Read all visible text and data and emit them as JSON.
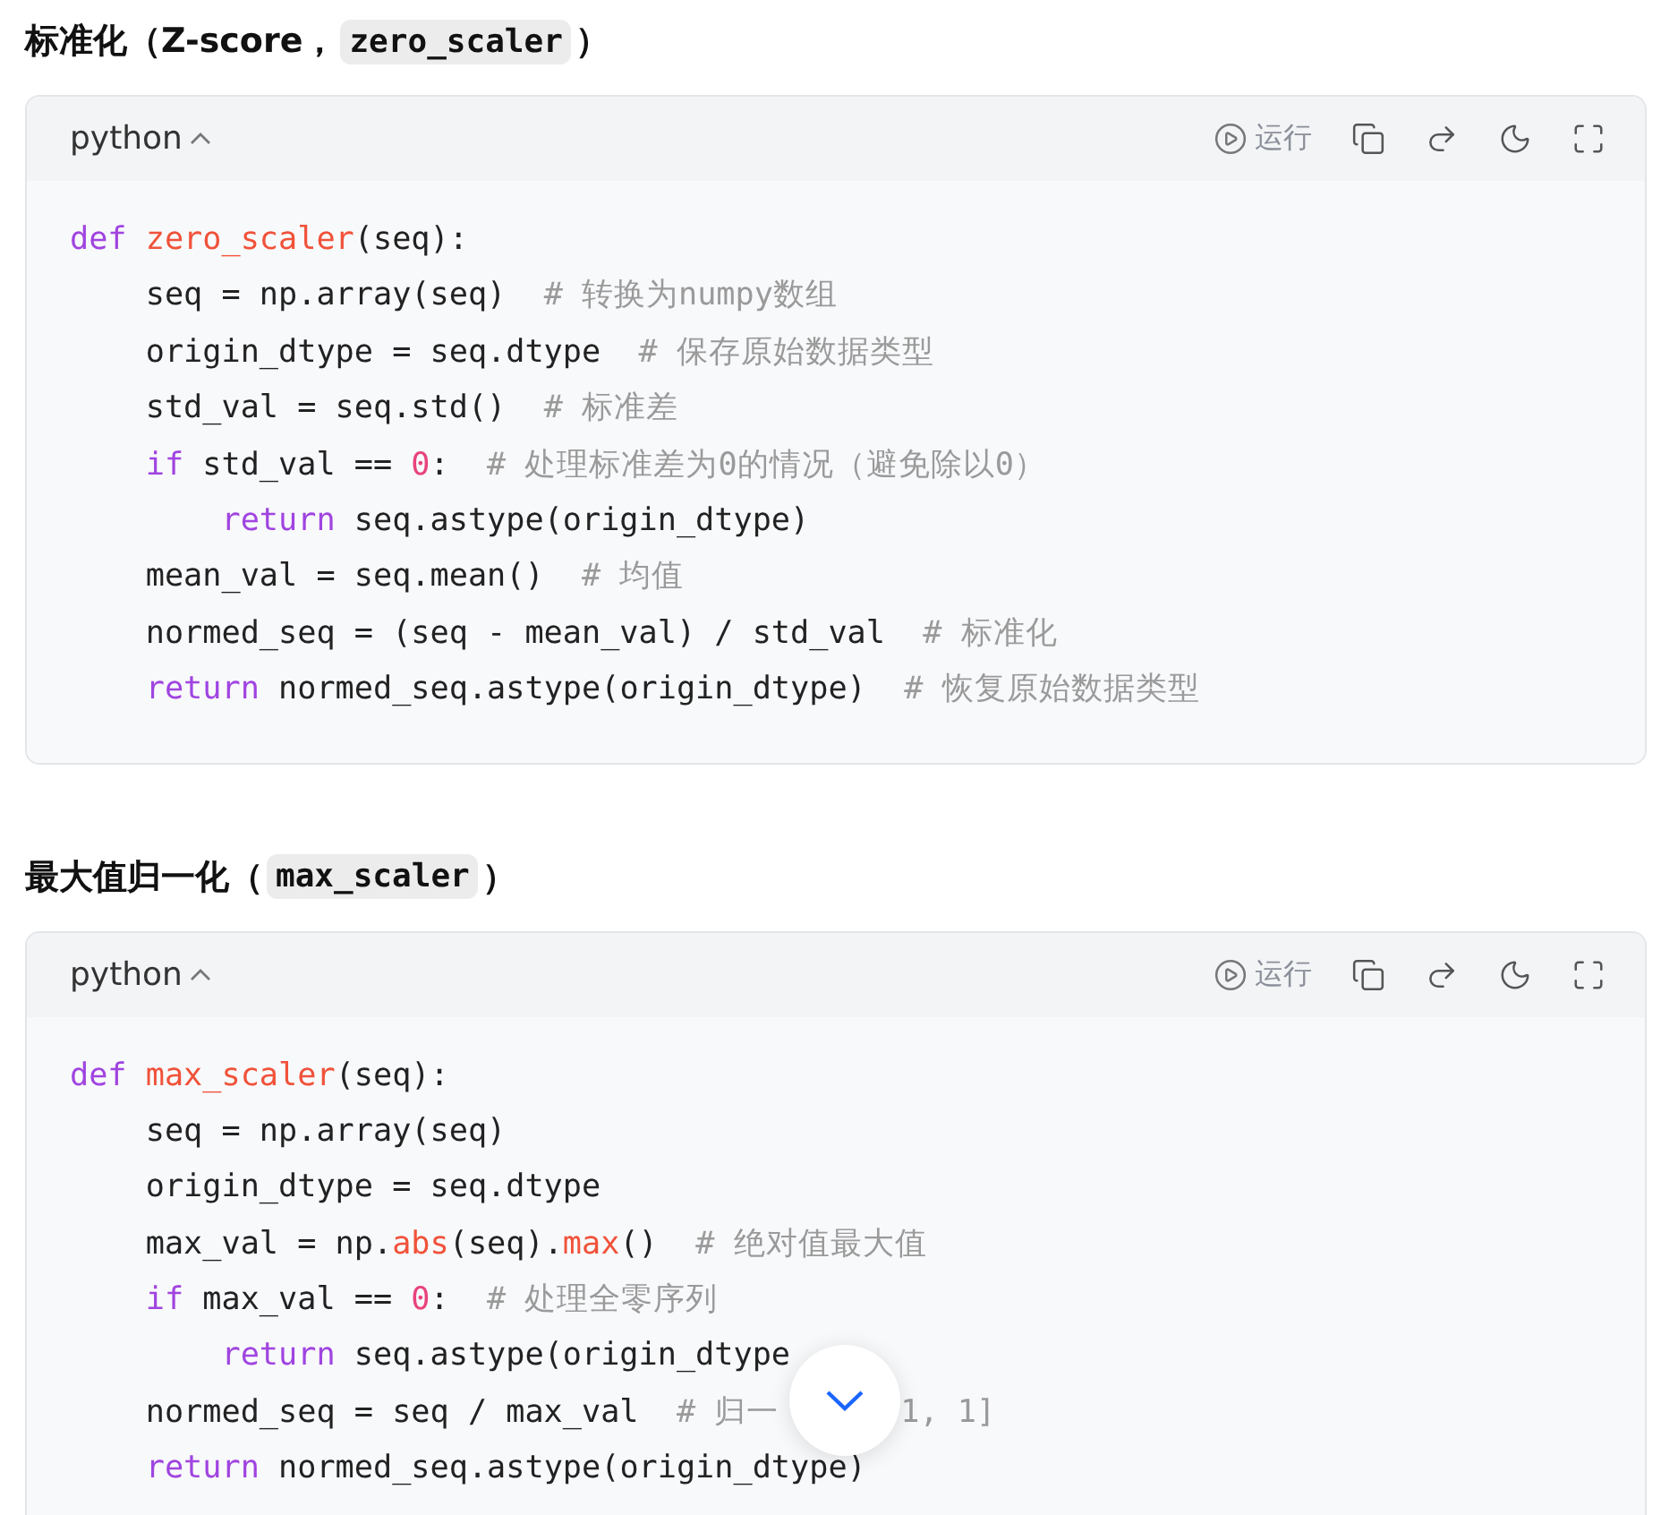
{
  "sections": [
    {
      "heading": [
        {
          "kind": "text",
          "text": "标准化（Z-score，"
        },
        {
          "kind": "code",
          "text": "zero_scaler"
        },
        {
          "kind": "text",
          "text": "）"
        }
      ],
      "code_block": {
        "language": "python",
        "run_label": "运行",
        "lines": [
          [
            {
              "kind": "keyword",
              "text": "def "
            },
            {
              "kind": "function",
              "text": "zero_scaler"
            },
            {
              "kind": "plain",
              "text": "(seq):"
            }
          ],
          [
            {
              "kind": "plain",
              "text": "    seq = np.array(seq)  "
            },
            {
              "kind": "comment",
              "text": "# 转换为numpy数组"
            }
          ],
          [
            {
              "kind": "plain",
              "text": "    origin_dtype = seq.dtype  "
            },
            {
              "kind": "comment",
              "text": "# 保存原始数据类型"
            }
          ],
          [
            {
              "kind": "plain",
              "text": "    std_val = seq.std()  "
            },
            {
              "kind": "comment",
              "text": "# 标准差"
            }
          ],
          [
            {
              "kind": "keyword",
              "text": "    if"
            },
            {
              "kind": "plain",
              "text": " std_val == "
            },
            {
              "kind": "number",
              "text": "0"
            },
            {
              "kind": "plain",
              "text": ":  "
            },
            {
              "kind": "comment",
              "text": "# 处理标准差为0的情况（避免除以0）"
            }
          ],
          [
            {
              "kind": "keyword",
              "text": "        return"
            },
            {
              "kind": "plain",
              "text": " seq.astype(origin_dtype)"
            }
          ],
          [
            {
              "kind": "plain",
              "text": "    mean_val = seq.mean()  "
            },
            {
              "kind": "comment",
              "text": "# 均值"
            }
          ],
          [
            {
              "kind": "plain",
              "text": "    normed_seq = (seq - mean_val) / std_val  "
            },
            {
              "kind": "comment",
              "text": "# 标准化"
            }
          ],
          [
            {
              "kind": "keyword",
              "text": "    return"
            },
            {
              "kind": "plain",
              "text": " normed_seq.astype(origin_dtype)  "
            },
            {
              "kind": "comment",
              "text": "# 恢复原始数据类型"
            }
          ]
        ]
      }
    },
    {
      "heading": [
        {
          "kind": "text",
          "text": "最大值归一化（"
        },
        {
          "kind": "code",
          "text": "max_scaler"
        },
        {
          "kind": "text",
          "text": "）"
        }
      ],
      "code_block": {
        "language": "python",
        "run_label": "运行",
        "lines": [
          [
            {
              "kind": "keyword",
              "text": "def "
            },
            {
              "kind": "function",
              "text": "max_scaler"
            },
            {
              "kind": "plain",
              "text": "(seq):"
            }
          ],
          [
            {
              "kind": "plain",
              "text": "    seq = np.array(seq)"
            }
          ],
          [
            {
              "kind": "plain",
              "text": "    origin_dtype = seq.dtype"
            }
          ],
          [
            {
              "kind": "plain",
              "text": "    max_val = np."
            },
            {
              "kind": "function",
              "text": "abs"
            },
            {
              "kind": "plain",
              "text": "(seq)."
            },
            {
              "kind": "function",
              "text": "max"
            },
            {
              "kind": "plain",
              "text": "()  "
            },
            {
              "kind": "comment",
              "text": "# 绝对值最大值"
            }
          ],
          [
            {
              "kind": "keyword",
              "text": "    if"
            },
            {
              "kind": "plain",
              "text": " max_val == "
            },
            {
              "kind": "number",
              "text": "0"
            },
            {
              "kind": "plain",
              "text": ":  "
            },
            {
              "kind": "comment",
              "text": "# 处理全零序列"
            }
          ],
          [
            {
              "kind": "keyword",
              "text": "        return"
            },
            {
              "kind": "plain",
              "text": " seq.astype(origin_dtype"
            }
          ],
          [
            {
              "kind": "plain",
              "text": "    normed_seq = seq / max_val  "
            },
            {
              "kind": "comment",
              "text": "# 归一"
            },
            {
              "kind": "covered_tail",
              "text": "1, 1]"
            }
          ],
          [
            {
              "kind": "keyword",
              "text": "    return"
            },
            {
              "kind": "plain",
              "text": " normed_seq.astype(origin_dtype)"
            }
          ]
        ]
      }
    }
  ]
}
